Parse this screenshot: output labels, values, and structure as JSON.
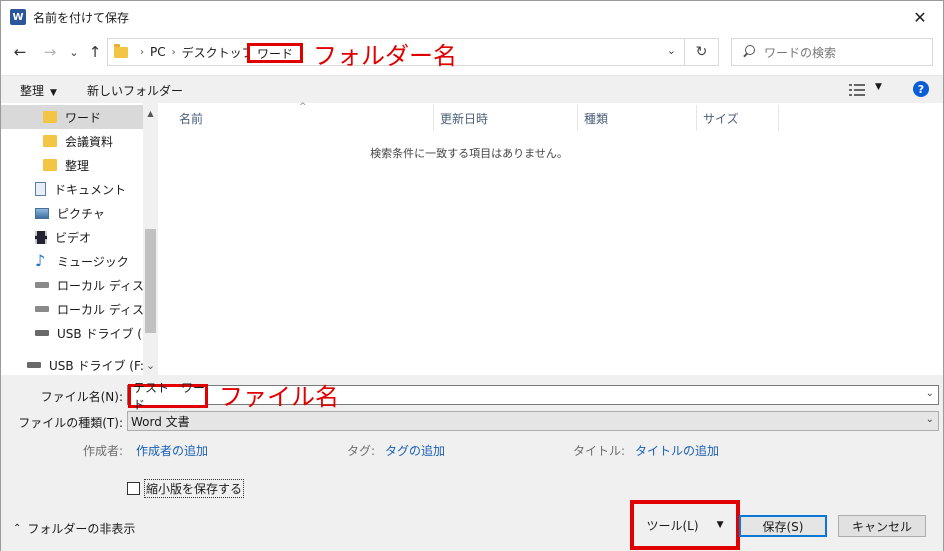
{
  "window": {
    "title": "名前を付けて保存",
    "app_icon_letter": "W",
    "close_glyph": "✕"
  },
  "nav": {
    "back_glyph": "←",
    "forward_glyph": "→",
    "recent_glyph": "⌄",
    "up_glyph": "↑"
  },
  "address": {
    "breadcrumbs": [
      "PC",
      "デスクトップ",
      "ワード"
    ],
    "sep_glyph": "›",
    "refresh_glyph": "↻",
    "drop_glyph": "⌄"
  },
  "search": {
    "placeholder": "ワードの検索"
  },
  "annotations": {
    "folder_name": "フォルダー名",
    "file_name": "ファイル名"
  },
  "toolbar": {
    "organize": "整理",
    "new_folder": "新しいフォルダー",
    "arrow": "▼",
    "help": "?"
  },
  "sidebar": {
    "items": [
      {
        "label": "ワード",
        "icon": "folder-icon"
      },
      {
        "label": "会議資料",
        "icon": "folder-icon"
      },
      {
        "label": "整理",
        "icon": "folder-icon"
      },
      {
        "label": "ドキュメント",
        "icon": "document-icon"
      },
      {
        "label": "ピクチャ",
        "icon": "pictures-icon"
      },
      {
        "label": "ビデオ",
        "icon": "videos-icon"
      },
      {
        "label": "ミュージック",
        "icon": "music-icon"
      },
      {
        "label": "ローカル ディスク (C",
        "icon": "disk-icon"
      },
      {
        "label": "ローカル ディスク (D",
        "icon": "disk-icon"
      },
      {
        "label": "USB ドライブ (F:)",
        "icon": "usb-drive-icon"
      },
      {
        "label": "USB ドライブ (F:)",
        "icon": "usb-drive-icon"
      }
    ],
    "music_glyph": "♪",
    "scroll_up": "▲",
    "scroll_down": "⌄"
  },
  "filelist": {
    "columns": [
      "名前",
      "更新日時",
      "種類",
      "サイズ"
    ],
    "sort_caret": "^",
    "empty_message": "検索条件に一致する項目はありません。"
  },
  "form": {
    "filename_label": "ファイル名(N):",
    "filename_value": "テスト　ワード",
    "filetype_label": "ファイルの種類(T):",
    "filetype_value": "Word 文書",
    "author_label": "作成者:",
    "author_link": "作成者の追加",
    "tags_label": "タグ:",
    "tags_link": "タグの追加",
    "title_label": "タイトル:",
    "title_link": "タイトルの追加",
    "thumbnail_label": "縮小版を保存する",
    "thumbnail_checked": false,
    "combo_drop": "⌄"
  },
  "footer": {
    "hide_folders": "フォルダーの非表示",
    "hide_chevron": "⌃",
    "tools": "ツール(L)",
    "tools_drop": "▼",
    "save": "保存(S)",
    "cancel": "キャンセル"
  },
  "colors": {
    "annotation": "#e00000",
    "link": "#1a5fb4",
    "accent": "#0b78d7"
  }
}
